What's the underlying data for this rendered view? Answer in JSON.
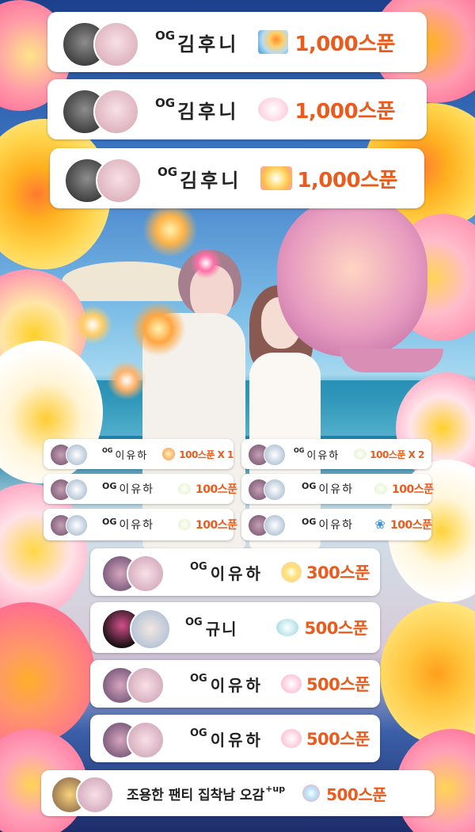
{
  "colors": {
    "amount": "#ec5a1c",
    "name": "#222222",
    "card": "#ffffff"
  },
  "donations": [
    {
      "og": "OG",
      "name": "김후니",
      "amount": "1,000스푼",
      "gift_icon": "lantern-gift-icon"
    },
    {
      "og": "OG",
      "name": "김후니",
      "amount": "1,000스푼",
      "gift_icon": "cloud-gift-icon"
    },
    {
      "og": "OG",
      "name": "김후니",
      "amount": "1,000스푼",
      "gift_icon": "sparkle-gift-icon"
    },
    {
      "og": "OG",
      "name": "이유하",
      "amount": "100스푼 X 1",
      "gift_icon": "crown-gift-icon"
    },
    {
      "og": "OG",
      "name": "이유하",
      "amount": "100스푼 X 2",
      "gift_icon": "tiara-gift-icon"
    },
    {
      "og": "OG",
      "name": "이유하",
      "amount": "100스푼",
      "gift_icon": "tiara-gift-icon"
    },
    {
      "og": "OG",
      "name": "이유하",
      "amount": "100스푼",
      "gift_icon": "tiara-gift-icon"
    },
    {
      "og": "OG",
      "name": "이유하",
      "amount": "100스푼",
      "gift_icon": "tiara-gift-icon"
    },
    {
      "og": "OG",
      "name": "이유하",
      "amount": "100스푼",
      "gift_icon": "butterfly-gift-icon"
    },
    {
      "og": "OG",
      "name": "이유하",
      "amount": "300스푼",
      "gift_icon": "firework-gift-icon"
    },
    {
      "og": "OG",
      "name": "규니",
      "amount": "500스푼",
      "gift_icon": "cloud-gift-icon"
    },
    {
      "og": "OG",
      "name": "이유하",
      "amount": "500스푼",
      "gift_icon": "flower-gift-icon"
    },
    {
      "og": "OG",
      "name": "이유하",
      "amount": "500스푼",
      "gift_icon": "flower-gift-icon"
    },
    {
      "og": "",
      "name": "조용한 팬티 집착남 오감",
      "suffix": "+up",
      "amount": "500스푼",
      "gift_icon": "firework-gift-icon"
    }
  ]
}
